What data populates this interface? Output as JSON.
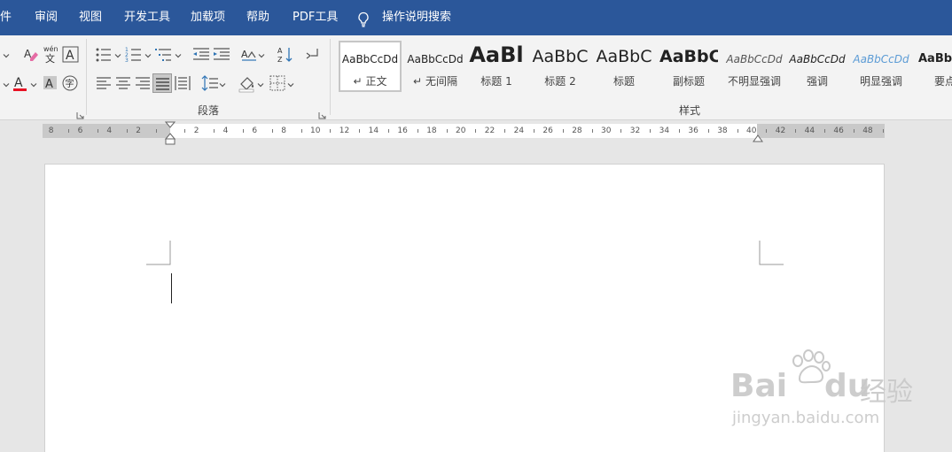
{
  "menu": {
    "items": [
      "件",
      "审阅",
      "视图",
      "开发工具",
      "加载项",
      "帮助",
      "PDF工具",
      "操作说明搜索"
    ]
  },
  "ribbon": {
    "groups": {
      "paragraph": "段落",
      "styles": "样式"
    },
    "font_icons": {
      "pinyin_top": "wén",
      "pinyin_bottom": "文",
      "char_border": "A",
      "font_color": "A",
      "char_shading": "A",
      "enclosed_char": "字"
    },
    "styles": [
      {
        "sample": "AaBbCcDd",
        "name": "正文",
        "marker": "↵",
        "selected": true
      },
      {
        "sample": "AaBbCcDd",
        "name": "无间隔",
        "marker": "↵"
      },
      {
        "sample": "AaBl",
        "name": "标题 1"
      },
      {
        "sample": "AaBbC",
        "name": "标题 2"
      },
      {
        "sample": "AaBbC",
        "name": "标题"
      },
      {
        "sample": "AaBbC",
        "name": "副标题"
      },
      {
        "sample": "AaBbCcDd",
        "name": "不明显强调"
      },
      {
        "sample": "AaBbCcDd",
        "name": "强调"
      },
      {
        "sample": "AaBbCcDd",
        "name": "明显强调"
      },
      {
        "sample": "AaBbC",
        "name": "要点"
      }
    ]
  },
  "ruler": {
    "left_numbers": [
      "8",
      "6",
      "4",
      "2"
    ],
    "right_numbers": [
      "2",
      "4",
      "6",
      "8",
      "10",
      "12",
      "14",
      "16",
      "18",
      "20",
      "22",
      "24",
      "26",
      "28",
      "30",
      "32",
      "34",
      "36",
      "38",
      "40",
      "42",
      "44",
      "46",
      "48"
    ]
  },
  "watermark": {
    "brand": "Bai",
    "brand_tail": "du",
    "brand_cn": "经验",
    "url": "jingyan.baidu.com"
  },
  "colors": {
    "menubar": "#2b579a",
    "font_color_bar": "#e81123",
    "heading_blue": "#2e74b5",
    "emphasis_blue": "#5b9bd5"
  }
}
